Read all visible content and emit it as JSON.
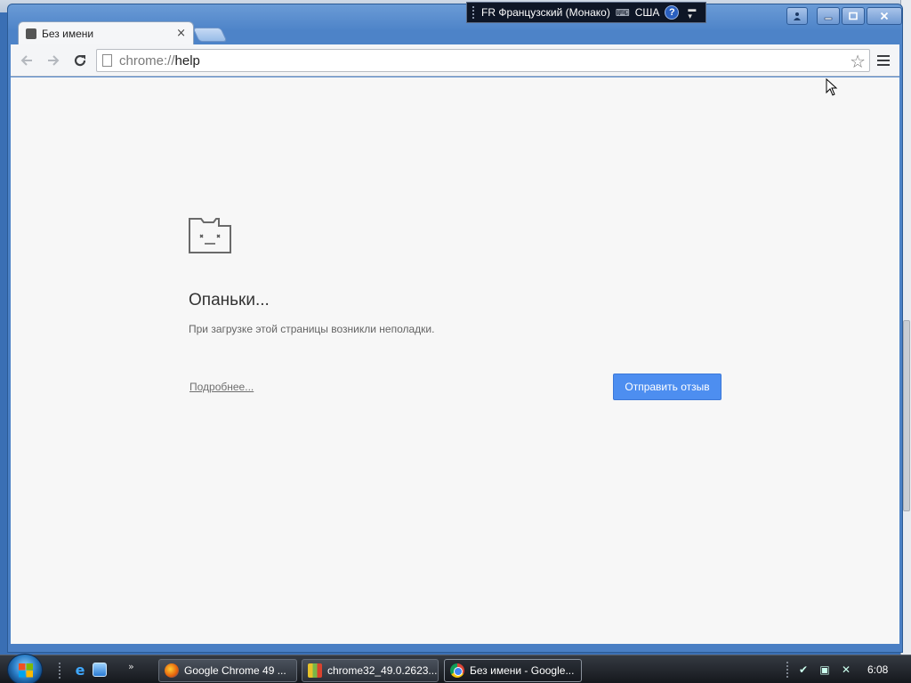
{
  "language_bar": {
    "language": "FR Французский (Монако)",
    "layout": "США",
    "help_glyph": "?"
  },
  "window": {
    "caption_buttons": {
      "user": "user-icon",
      "minimize": "minimize-icon",
      "maximize": "maximize-icon",
      "close": "close-icon"
    }
  },
  "tab": {
    "title": "Без имени",
    "close_glyph": "×"
  },
  "toolbar": {
    "url_scheme": "chrome://",
    "url_path": "help"
  },
  "error_page": {
    "heading": "Опаньки...",
    "message": "При загрузке этой страницы возникли неполадки.",
    "details_link": "Подробнее...",
    "feedback_button": "Отправить отзыв"
  },
  "taskbar": {
    "quick_launch_more": "»",
    "buttons": [
      {
        "label": "Google Chrome 49 ...",
        "icon": "firefox-icon"
      },
      {
        "label": "chrome32_49.0.2623....",
        "icon": "archive-icon"
      },
      {
        "label": "Без имени - Google...",
        "icon": "chrome-icon"
      }
    ],
    "clock": "6:08"
  },
  "colors": {
    "accent_blue": "#4d8ef0",
    "window_frame": "#4a7fc4",
    "page_background": "#f7f7f7"
  }
}
